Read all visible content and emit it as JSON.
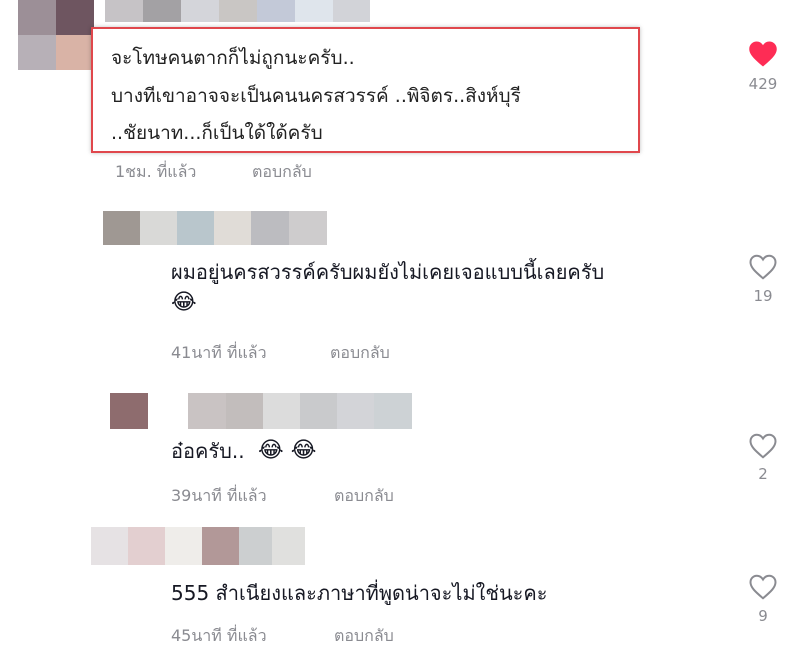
{
  "comments": [
    {
      "lines": [
        "จะโทษคนตากก็ไม่ถูกนะครับ..",
        "บางทีเขาอาจจะเป็นคนนครสวรรค์ ..พิจิตร..สิงห์บุรี",
        "..ชัยนาท...ก็เป็นใด้ใด้ครับ"
      ],
      "time": "1ชม. ที่แล้ว",
      "reply_label": "ตอบกลับ",
      "likes": "429",
      "liked": true
    },
    {
      "text": "ผมอยู่นครสวรรค์ครับผมยังไม่เคยเจอแบบนี้เลยครับ",
      "emoji": "😂",
      "time": "41นาที ที่แล้ว",
      "reply_label": "ตอบกลับ",
      "likes": "19",
      "liked": false
    },
    {
      "text": "อ๋อครับ..",
      "emoji": "😂 😂",
      "time": "39นาที ที่แล้ว",
      "reply_label": "ตอบกลับ",
      "likes": "2",
      "liked": false
    },
    {
      "text": "555 สำเนียงและภาษาที่พูดน่าจะไม่ใช่นะคะ",
      "time": "45นาที ที่แล้ว",
      "reply_label": "ตอบกลับ",
      "likes": "9",
      "liked": false
    }
  ],
  "colors": {
    "liked_heart": "#fe2c55",
    "highlight_border": "#e0474c",
    "meta_text": "#8a8b91"
  },
  "icons": [
    "heart-filled-icon",
    "heart-outline-icon"
  ]
}
